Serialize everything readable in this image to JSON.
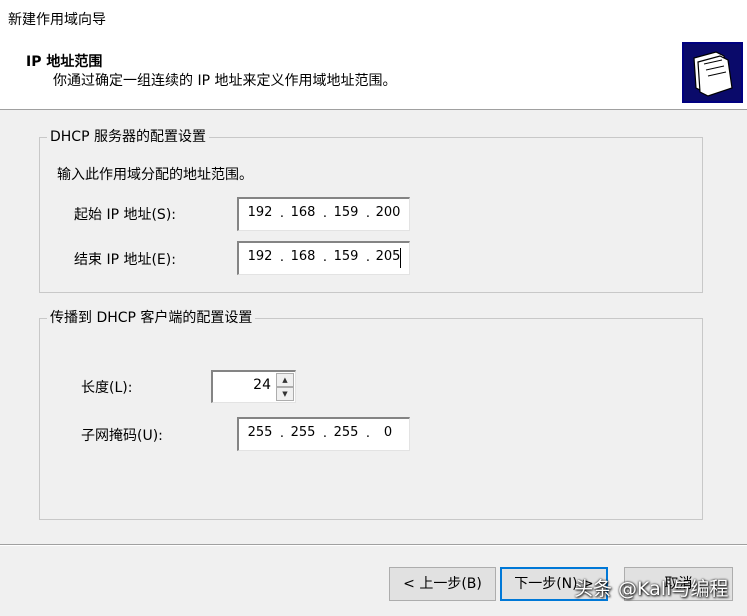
{
  "window": {
    "title": "新建作用域向导"
  },
  "header": {
    "title": "IP 地址范围",
    "subtitle": "你通过确定一组连续的 IP 地址来定义作用域地址范围。",
    "icon": "wizard-folders-icon"
  },
  "server_group": {
    "legend": "DHCP 服务器的配置设置",
    "instruction": "输入此作用域分配的地址范围。",
    "start_label": "起始 IP 地址(S):",
    "start_ip": [
      "192",
      "168",
      "159",
      "200"
    ],
    "end_label": "结束 IP 地址(E):",
    "end_ip": [
      "192",
      "168",
      "159",
      "205"
    ]
  },
  "client_group": {
    "legend": "传播到 DHCP 客户端的配置设置",
    "length_label": "长度(L):",
    "length_value": "24",
    "mask_label": "子网掩码(U):",
    "mask_ip": [
      "255",
      "255",
      "255",
      "0"
    ]
  },
  "footer": {
    "back_label": "< 上一步(B)",
    "next_label": "下一步(N) >",
    "cancel_label": "取消"
  },
  "watermark": {
    "text": "头条 @Kali与编程"
  },
  "colors": {
    "accent": "#0078d7",
    "icon_border": "#000080"
  }
}
